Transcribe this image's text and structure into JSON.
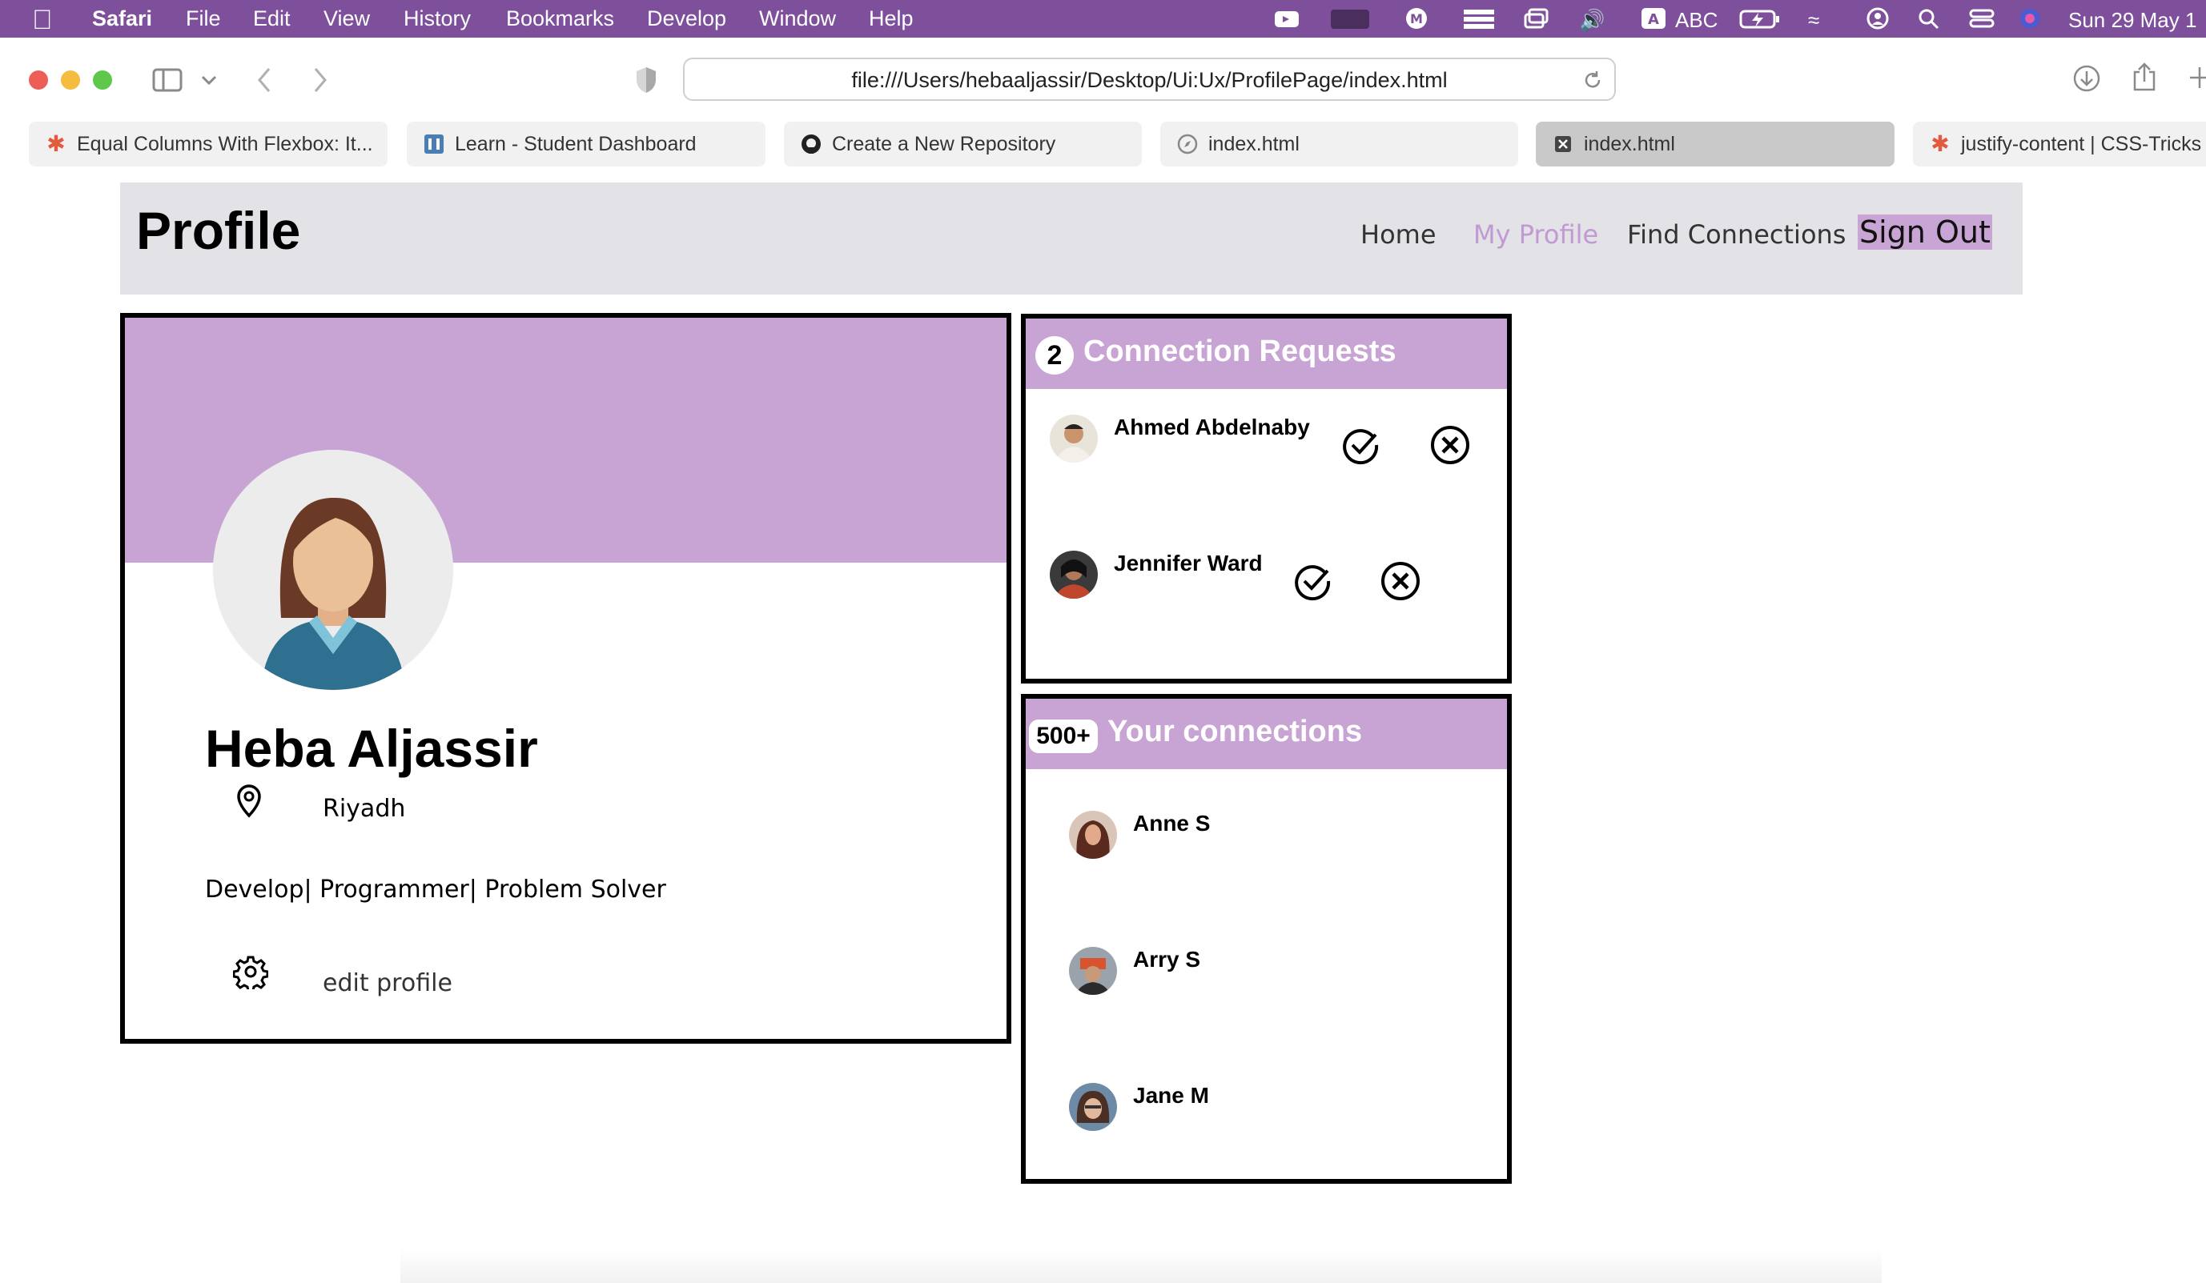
{
  "menubar": {
    "app_name": "Safari",
    "items": [
      "File",
      "Edit",
      "View",
      "History",
      "Bookmarks",
      "Develop",
      "Window",
      "Help"
    ],
    "input_source": "ABC",
    "datetime": "Sun 29 May  1"
  },
  "browser": {
    "url": "file:///Users/hebaaljassir/Desktop/Ui:Ux/ProfilePage/index.html",
    "tabs": [
      {
        "label": "Equal Columns With Flexbox: It...",
        "icon": "css-tricks-star-icon"
      },
      {
        "label": "Learn - Student Dashboard",
        "icon": "learn-dashboard-icon"
      },
      {
        "label": "Create a New Repository",
        "icon": "github-icon"
      },
      {
        "label": "index.html",
        "icon": "compass-icon"
      },
      {
        "label": "index.html",
        "icon": "close-tab-icon",
        "active": true
      },
      {
        "label": "justify-content | CSS-Tricks",
        "icon": "css-tricks-star-icon"
      }
    ]
  },
  "header": {
    "title": "Profile",
    "nav": {
      "home": "Home",
      "my_profile": "My Profile",
      "find_connections": "Find Connections",
      "sign_out": "Sign Out"
    }
  },
  "profile": {
    "name": "Heba Aljassir",
    "location": "Riyadh",
    "bio": "Develop| Programmer| Problem Solver",
    "edit_label": "edit profile"
  },
  "requests": {
    "count": "2",
    "title": "Connection Requests",
    "people": [
      {
        "name": "Ahmed Abdelnaby"
      },
      {
        "name": "Jennifer Ward"
      }
    ]
  },
  "connections": {
    "count": "500+",
    "title": "Your connections",
    "people": [
      {
        "name": "Anne S"
      },
      {
        "name": "Arry S"
      },
      {
        "name": "Jane M"
      }
    ]
  },
  "colors": {
    "menubar": "#7e4f9b",
    "accent": "#c8a4d4",
    "header_bg": "#e3e2e7",
    "nav_current": "#c09ad2"
  }
}
